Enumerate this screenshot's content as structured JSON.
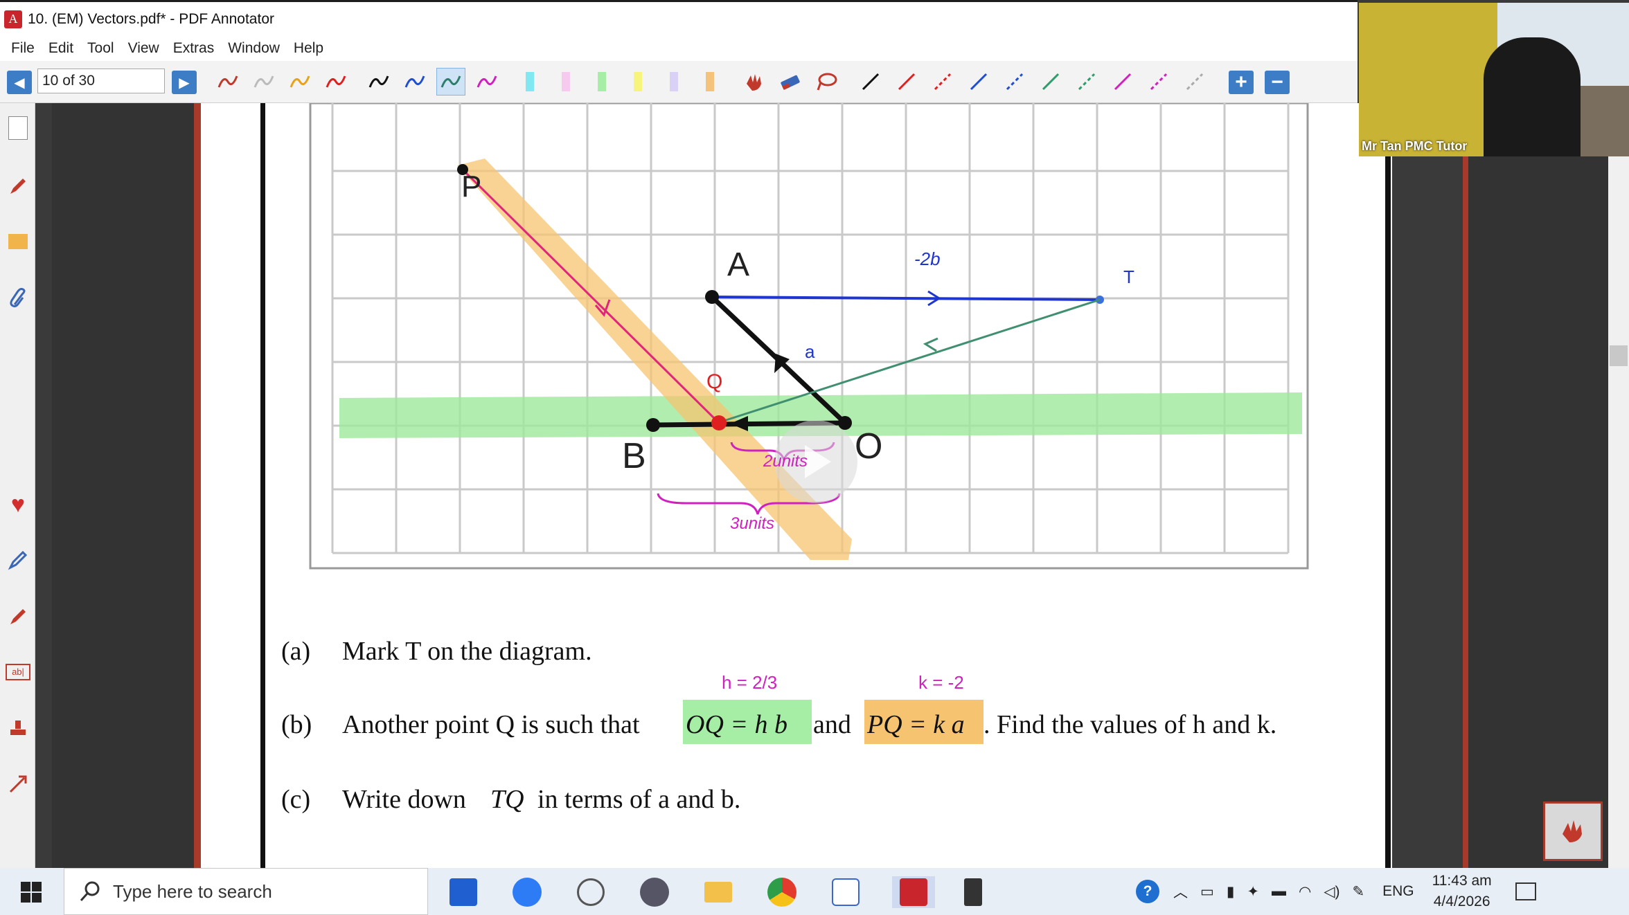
{
  "window": {
    "title": "10. (EM) Vectors.pdf* - PDF Annotator",
    "app_icon_letter": "A"
  },
  "menu": [
    "File",
    "Edit",
    "Tool",
    "View",
    "Extras",
    "Window",
    "Help"
  ],
  "toolbar": {
    "page_indicator": "10 of 30",
    "prev_icon": "◀",
    "next_icon": "▶",
    "zoom_in": "+",
    "zoom_out": "−"
  },
  "webcam": {
    "name_label": "Mr Tan PMC Tutor"
  },
  "diagram": {
    "point_labels": {
      "P": "P",
      "A": "A",
      "T": "T",
      "Q": "Q",
      "B": "B",
      "O": "O"
    },
    "annotations": {
      "minus_2b": "-2b",
      "a": "a",
      "two_units": "2units",
      "three_units": "3units"
    }
  },
  "questions": {
    "a": {
      "label": "(a)",
      "text": "Mark T on the diagram."
    },
    "b": {
      "label": "(b)",
      "pre": "Another point Q is such that",
      "eq1": "OQ = h b",
      "mid": "and",
      "eq2": "PQ = k a",
      "post": ". Find the values of h and k."
    },
    "c": {
      "label": "(c)",
      "pre": "Write down",
      "vec": "TQ",
      "post": "in terms of a and b."
    },
    "handwritten": {
      "h_value": "h = 2/3",
      "k_value": "k = -2"
    }
  },
  "taskbar": {
    "search_placeholder": "Type here to search",
    "language": "ENG",
    "time": "11:43 am",
    "date": "4/4/2026"
  }
}
